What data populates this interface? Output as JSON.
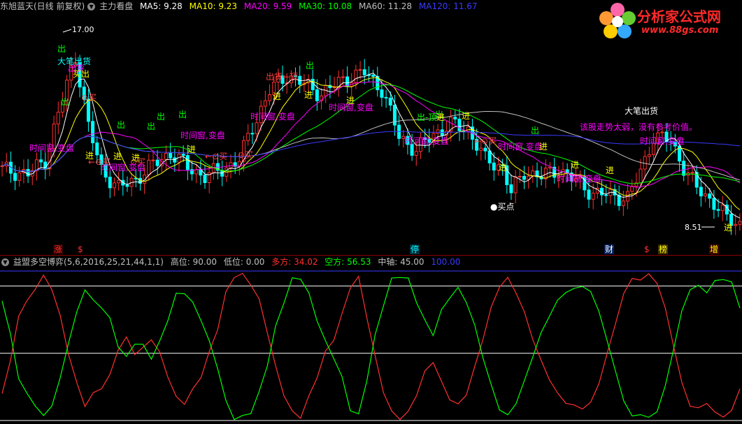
{
  "top_header": {
    "stock": "东旭蓝天(日线 前复权)",
    "indicator": "主力看盘",
    "ma": [
      {
        "label": "MA5: 9.28",
        "color": "#ffffff"
      },
      {
        "label": "MA10: 9.23",
        "color": "#ffff00"
      },
      {
        "label": "MA20: 9.59",
        "color": "#ff00ff"
      },
      {
        "label": "MA30: 10.08",
        "color": "#00ff00"
      },
      {
        "label": "MA60: 11.28",
        "color": "#c0c0c0"
      },
      {
        "label": "MA120: 11.67",
        "color": "#3a3aff"
      }
    ]
  },
  "bottom_header": {
    "indicator": "益盟多空博弈",
    "params": "(5,6,2016,25,21,44,1,1)",
    "values": [
      {
        "label": "高位: 90.00",
        "color": "#c0c0c0"
      },
      {
        "label": "低位: 0.00",
        "color": "#c0c0c0"
      },
      {
        "label": "多方: 34.02",
        "color": "#ff3030"
      },
      {
        "label": "空方: 56.53",
        "color": "#00ff00"
      },
      {
        "label": "中轴: 45.00",
        "color": "#c0c0c0"
      },
      {
        "label": "100.00",
        "color": "#3a3aff"
      }
    ]
  },
  "logo": {
    "title": "分析家公式网",
    "url": "www.88gs.com"
  },
  "chart_data": [
    {
      "type": "candlestick",
      "price_range": [
        8.2,
        17.6
      ],
      "high_label": "17.00",
      "low_label": "8.51",
      "annotations": [
        {
          "text": "大笔出货",
          "color": "#00ffff"
        },
        {
          "text": "大笔出货",
          "color": "#ffffff"
        },
        {
          "text": "出货",
          "color": "#ff00ff"
        },
        {
          "text": "买出",
          "color": "#ffff00"
        },
        {
          "text": "出",
          "color": "#00ff00"
        },
        {
          "text": "出",
          "color": "#00ff00"
        },
        {
          "text": "出",
          "color": "#00ff00"
        },
        {
          "text": "出",
          "color": "#00ff00"
        },
        {
          "text": "出",
          "color": "#00ff00"
        },
        {
          "text": "出",
          "color": "#00ff00"
        },
        {
          "text": "出",
          "color": "#00ff00"
        },
        {
          "text": "出",
          "color": "#00ff00"
        },
        {
          "text": "出",
          "color": "#00ff00"
        },
        {
          "text": "出-顶",
          "color": "#00ff00"
        },
        {
          "text": "出货←顶",
          "color": "#ff4040"
        },
        {
          "text": "⊙买",
          "color": "#ff4040"
        },
        {
          "text": "⊙买",
          "color": "#ff4040"
        },
        {
          "text": "⊙买",
          "color": "#ff4040"
        },
        {
          "text": "←⊙买",
          "color": "#ff4040"
        },
        {
          "text": "←⊙买",
          "color": "#ff4040"
        },
        {
          "text": "←⊙买",
          "color": "#ff4040"
        },
        {
          "text": "时间窗,变盘",
          "color": "#ff00ff"
        },
        {
          "text": "时间窗,变盘",
          "color": "#ff00ff"
        },
        {
          "text": "时间窗,变盘",
          "color": "#ff00ff"
        },
        {
          "text": "时间窗,变盘",
          "color": "#ff00ff"
        },
        {
          "text": "时间窗,变盘",
          "color": "#ff00ff"
        },
        {
          "text": "时间窗,变盘",
          "color": "#ff00ff"
        },
        {
          "text": "时间窗,变盘",
          "color": "#ff00ff"
        },
        {
          "text": "时间窗,变盘",
          "color": "#ff00ff"
        },
        {
          "text": "时间窗,变盘",
          "color": "#ff00ff"
        },
        {
          "text": "进",
          "color": "#ffff00"
        },
        {
          "text": "进",
          "color": "#ffff00"
        },
        {
          "text": "进",
          "color": "#ffff00"
        },
        {
          "text": "进",
          "color": "#ffff00"
        },
        {
          "text": "进",
          "color": "#ffff00"
        },
        {
          "text": "进",
          "color": "#ffff00"
        },
        {
          "text": "进",
          "color": "#ffff00"
        },
        {
          "text": "进",
          "color": "#ffff00"
        },
        {
          "text": "进",
          "color": "#ffff00"
        },
        {
          "text": "进",
          "color": "#ffff00"
        },
        {
          "text": "进",
          "color": "#ffff00"
        },
        {
          "text": "进",
          "color": "#ffff00"
        },
        {
          "text": "进",
          "color": "#ffff00"
        },
        {
          "text": "进",
          "color": "#ffff00"
        },
        {
          "text": "该股走势太弱，没有参考价值。",
          "color": "#ff00ff"
        },
        {
          "text": "●买点",
          "color": "#ffffff"
        }
      ],
      "events": [
        {
          "text": "涨",
          "color": "#ff3030",
          "bg": "#300000"
        },
        {
          "text": "$",
          "color": "#ff3030",
          "bg": "#000000"
        },
        {
          "text": "停",
          "color": "#00ffff",
          "bg": "#003040"
        },
        {
          "text": "财",
          "color": "#ffffff",
          "bg": "#002060"
        },
        {
          "text": "$",
          "color": "#ff3030",
          "bg": "#000000"
        },
        {
          "text": "榜",
          "color": "#ffff00",
          "bg": "#403000"
        },
        {
          "text": "增",
          "color": "#ffff00",
          "bg": "#400000"
        }
      ]
    },
    {
      "type": "line",
      "ylim": [
        0,
        100
      ],
      "reference_lines": [
        {
          "value": 100,
          "color": "#3a3aff"
        },
        {
          "value": 90,
          "color": "#ffffff"
        },
        {
          "value": 45,
          "color": "#ffffff"
        },
        {
          "value": 0,
          "color": "#ffffff"
        }
      ],
      "series": [
        {
          "name": "多方",
          "color": "#ff3030",
          "values": [
            18,
            40,
            70,
            80,
            88,
            97,
            88,
            70,
            45,
            25,
            10,
            18,
            22,
            30,
            48,
            55,
            45,
            48,
            55,
            45,
            30,
            15,
            12,
            20,
            30,
            45,
            62,
            85,
            97,
            97,
            92,
            80,
            60,
            35,
            18,
            5,
            3,
            15,
            30,
            45,
            55,
            70,
            90,
            95,
            70,
            42,
            20,
            5,
            2,
            5,
            18,
            32,
            40,
            25,
            15,
            10,
            18,
            35,
            55,
            75,
            90,
            95,
            86,
            72,
            55,
            40,
            28,
            18,
            12,
            10,
            8,
            12,
            25,
            45,
            65,
            85,
            95,
            94,
            98,
            92,
            75,
            50,
            25,
            10,
            8,
            12,
            5,
            3,
            6,
            22
          ]
        },
        {
          "name": "空方",
          "color": "#00ff00",
          "values": [
            80,
            58,
            28,
            18,
            10,
            3,
            10,
            28,
            52,
            72,
            88,
            80,
            76,
            68,
            50,
            42,
            52,
            50,
            42,
            52,
            68,
            84,
            86,
            78,
            68,
            52,
            36,
            12,
            2,
            2,
            6,
            18,
            38,
            62,
            80,
            94,
            96,
            84,
            68,
            52,
            43,
            28,
            8,
            3,
            28,
            56,
            78,
            94,
            97,
            94,
            80,
            66,
            58,
            73,
            83,
            88,
            80,
            63,
            43,
            23,
            8,
            3,
            12,
            26,
            43,
            58,
            70,
            80,
            86,
            88,
            90,
            86,
            73,
            53,
            33,
            13,
            3,
            4,
            2,
            6,
            23,
            48,
            73,
            88,
            90,
            86,
            93,
            95,
            92,
            76
          ]
        }
      ]
    }
  ]
}
